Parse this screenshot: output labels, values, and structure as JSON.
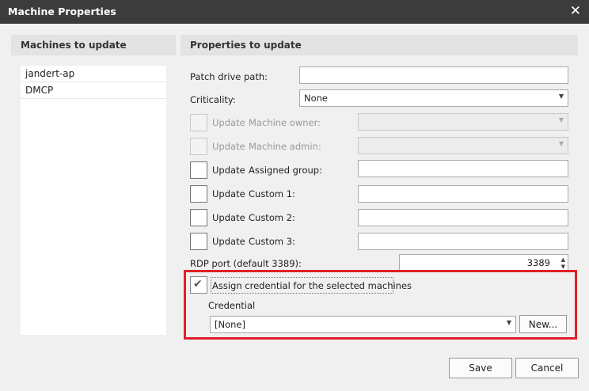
{
  "window": {
    "title": "Machine Properties"
  },
  "machines_panel": {
    "header": "Machines to update",
    "items": [
      "jandert-ap",
      "DMCP"
    ]
  },
  "properties_panel": {
    "header": "Properties to update",
    "patch_drive_path_label": "Patch drive path:",
    "patch_drive_path_value": "",
    "criticality_label": "Criticality:",
    "criticality_value": "None",
    "update_label": "Update",
    "machine_owner_label": "Machine owner:",
    "machine_admin_label": "Machine admin:",
    "assigned_group_label": "Assigned group:",
    "custom1_label": "Custom 1:",
    "custom2_label": "Custom 2:",
    "custom3_label": "Custom 3:",
    "rdp_port_label": "RDP port (default 3389):",
    "rdp_port_value": "3389",
    "assign_credential_label": "Assign credential for the selected machines",
    "credential_label": "Credential",
    "credential_value": "[None]",
    "new_button": "New..."
  },
  "footer": {
    "save": "Save",
    "cancel": "Cancel"
  },
  "colors": {
    "titlebar": "#3c3c3c",
    "highlight": "#e02027"
  }
}
